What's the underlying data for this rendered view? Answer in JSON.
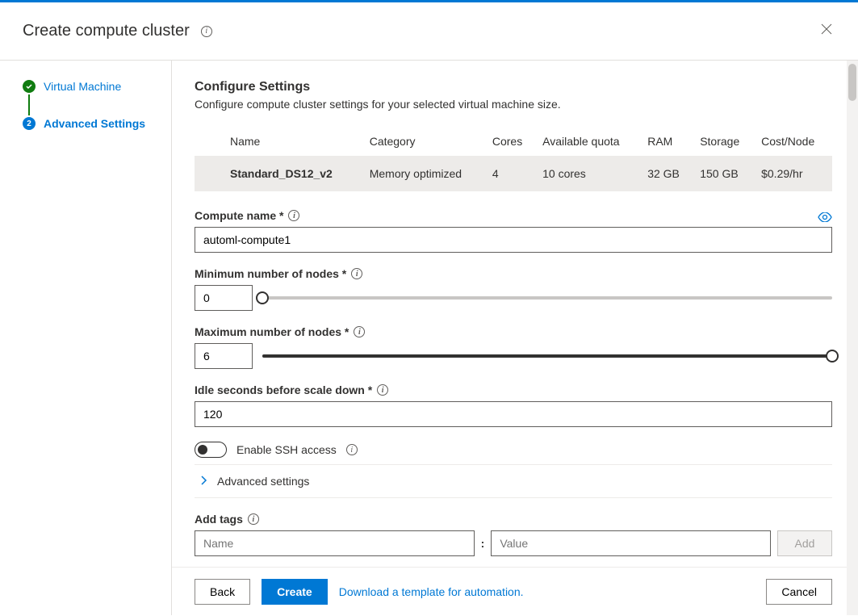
{
  "header": {
    "title": "Create compute cluster"
  },
  "steps": {
    "virtual_machine": "Virtual Machine",
    "advanced_settings": "Advanced Settings",
    "active_num": "2"
  },
  "section": {
    "title": "Configure Settings",
    "subtitle": "Configure compute cluster settings for your selected virtual machine size."
  },
  "vm_table": {
    "headers": {
      "name": "Name",
      "category": "Category",
      "cores": "Cores",
      "quota": "Available quota",
      "ram": "RAM",
      "storage": "Storage",
      "cost": "Cost/Node"
    },
    "row": {
      "name": "Standard_DS12_v2",
      "category": "Memory optimized",
      "cores": "4",
      "quota": "10 cores",
      "ram": "32 GB",
      "storage": "150 GB",
      "cost": "$0.29/hr"
    }
  },
  "fields": {
    "compute_name_label": "Compute name *",
    "compute_name_value": "automl-compute1",
    "min_nodes_label": "Minimum number of nodes *",
    "min_nodes_value": "0",
    "max_nodes_label": "Maximum number of nodes *",
    "max_nodes_value": "6",
    "idle_label": "Idle seconds before scale down *",
    "idle_value": "120",
    "ssh_label": "Enable SSH access",
    "advanced_label": "Advanced settings",
    "add_tags_label": "Add tags",
    "tag_name_placeholder": "Name",
    "tag_value_placeholder": "Value",
    "add_btn": "Add"
  },
  "footer": {
    "back": "Back",
    "create": "Create",
    "download_link": "Download a template for automation.",
    "cancel": "Cancel"
  }
}
